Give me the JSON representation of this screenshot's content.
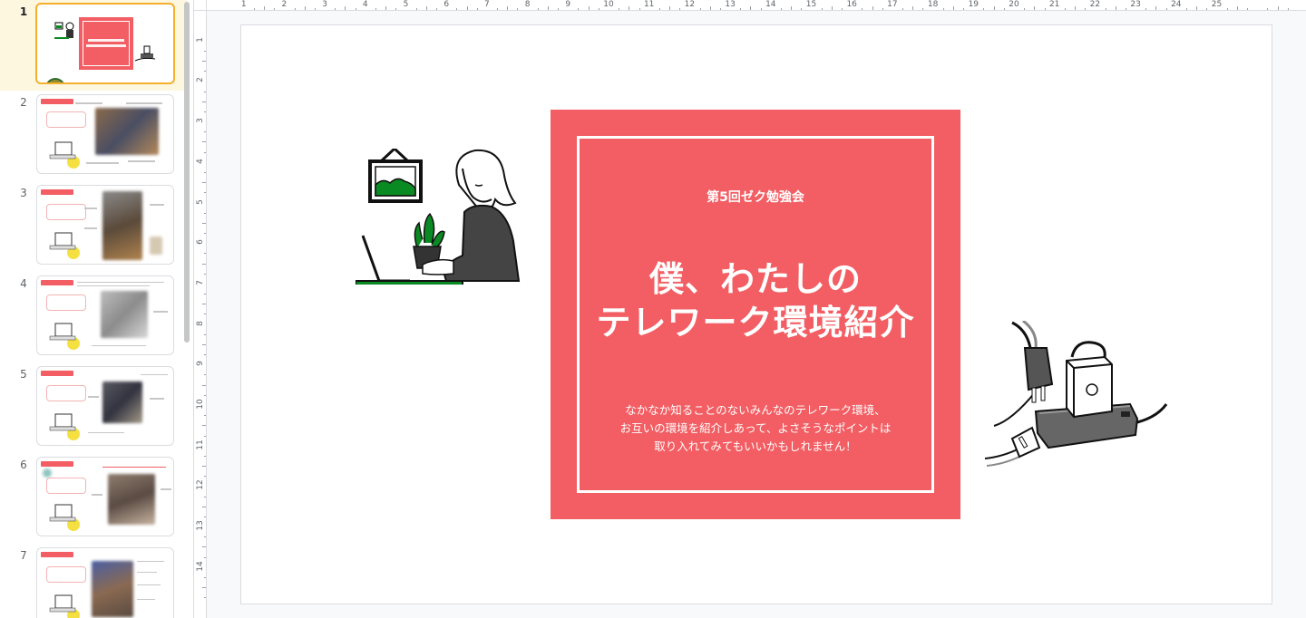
{
  "filmstrip": {
    "slides": [
      {
        "number": "1",
        "selected": true
      },
      {
        "number": "2",
        "selected": false
      },
      {
        "number": "3",
        "selected": false
      },
      {
        "number": "4",
        "selected": false
      },
      {
        "number": "5",
        "selected": false
      },
      {
        "number": "6",
        "selected": false
      },
      {
        "number": "7",
        "selected": false
      }
    ]
  },
  "ruler": {
    "horizontal": [
      "1",
      "2",
      "3",
      "4",
      "5",
      "6",
      "7",
      "8",
      "9",
      "10",
      "11",
      "12",
      "13",
      "14",
      "15",
      "16",
      "17",
      "18",
      "19",
      "20",
      "21",
      "22",
      "23",
      "24",
      "25"
    ],
    "vertical": [
      "1",
      "2",
      "3",
      "4",
      "5",
      "6",
      "7",
      "8",
      "9",
      "10",
      "11",
      "12",
      "13",
      "14"
    ]
  },
  "slide": {
    "subtitle": "第5回ゼク勉強会",
    "title_line1": "僕、わたしの",
    "title_line2": "テレワーク環境紹介",
    "description": [
      "なかなか知ることのないみんなのテレワーク環境、",
      "お互いの環境を紹介しあって、よさそうなポイントは",
      "取り入れてみてもいいかもしれません！"
    ]
  },
  "colors": {
    "accent_red": "#f25e63",
    "selection": "#f6ae2d",
    "plant_green": "#0a8a22"
  }
}
